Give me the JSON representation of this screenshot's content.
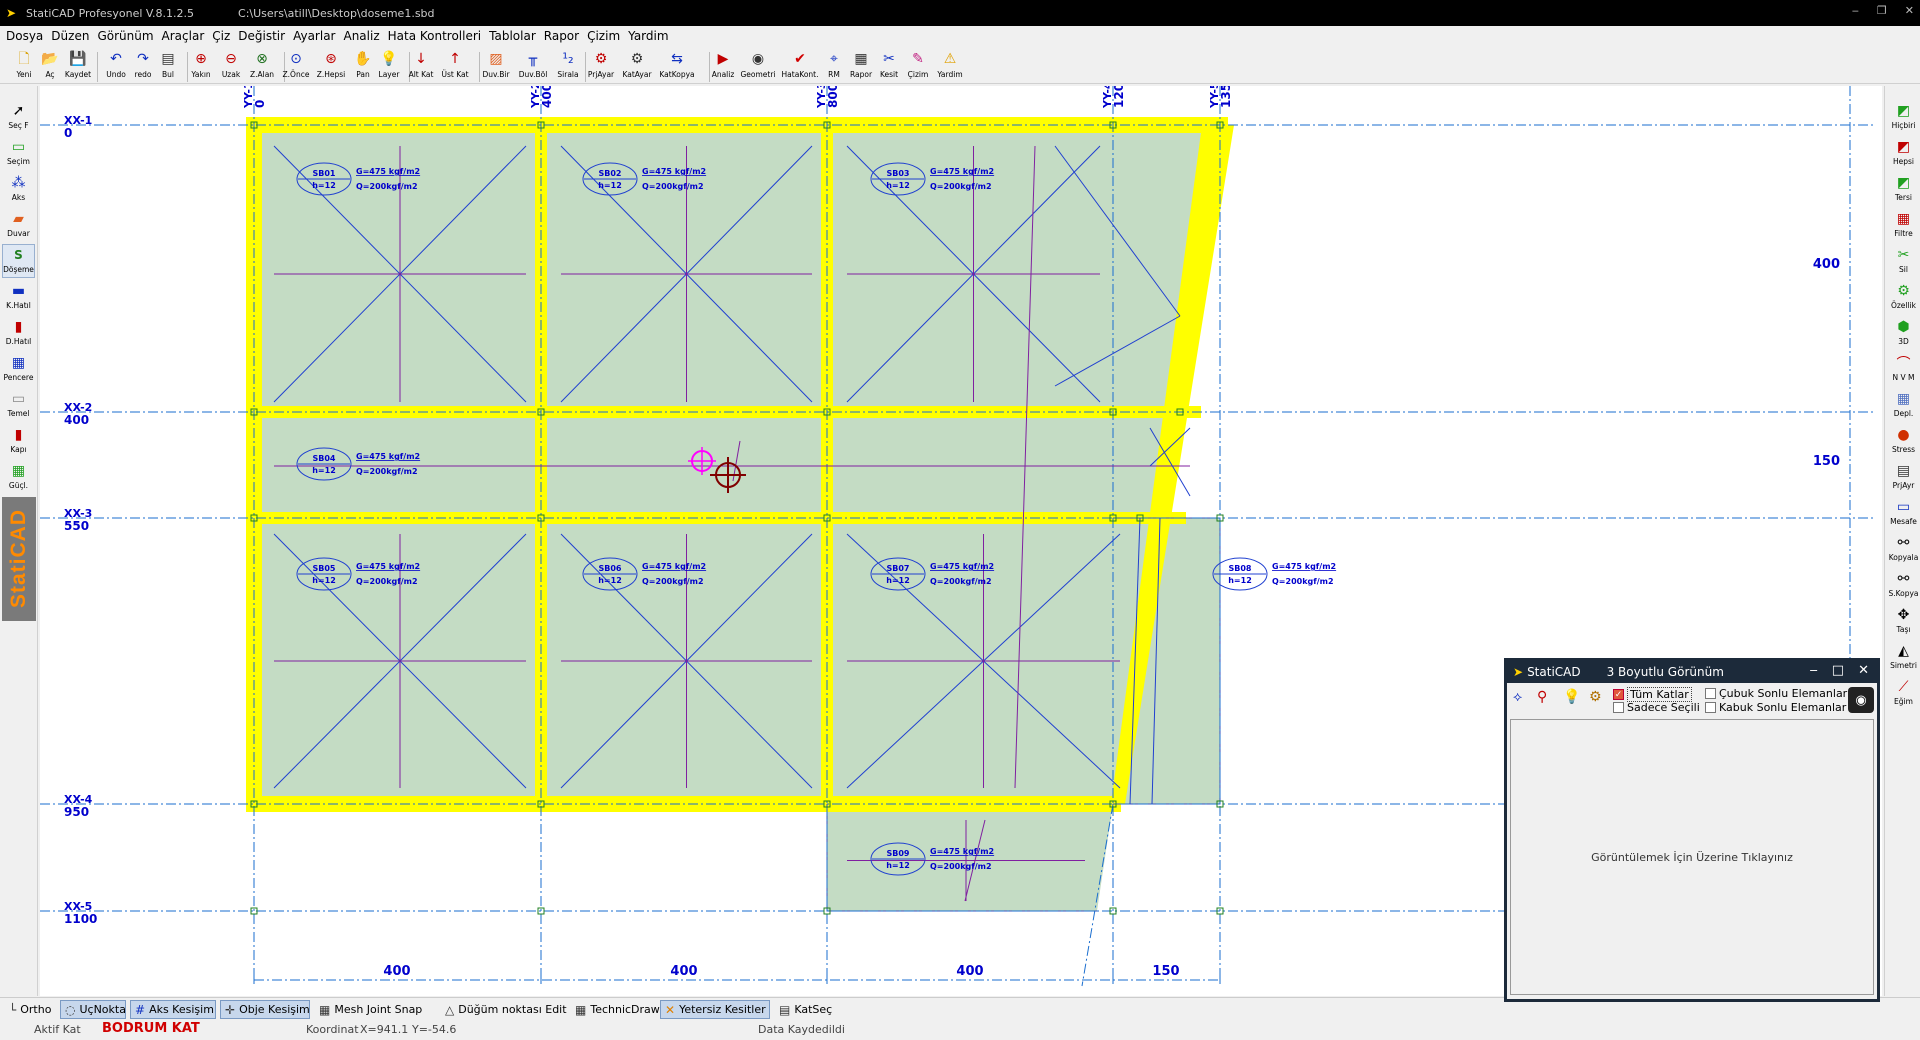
{
  "titlebar": {
    "title": "StatiCAD Profesyonel V.8.1.2.5",
    "path": "C:\\Users\\atill\\Desktop\\doseme1.sbd"
  },
  "menu": [
    "Dosya",
    "Düzen",
    "Görünüm",
    "Araçlar",
    "Çiz",
    "Değistir",
    "Ayarlar",
    "Analiz",
    "Hata Kontrolleri",
    "Tablolar",
    "Rapor",
    "Çizim",
    "Yardim"
  ],
  "toolbar": [
    {
      "label": "Yeni",
      "icon": "new-file-icon",
      "glyph": "🗋",
      "color": "#d8a000"
    },
    {
      "label": "Aç",
      "icon": "open-folder-icon",
      "glyph": "📂",
      "color": "#d8a000"
    },
    {
      "label": "Kaydet",
      "icon": "save-icon",
      "glyph": "💾",
      "color": "#203080"
    },
    {
      "label": "Undo",
      "icon": "undo-icon",
      "glyph": "↶",
      "color": "#1030c0"
    },
    {
      "label": "redo",
      "icon": "redo-icon",
      "glyph": "↷",
      "color": "#1030c0"
    },
    {
      "label": "Bul",
      "icon": "find-icon",
      "glyph": "▤",
      "color": "#333"
    },
    {
      "label": "Yakın",
      "icon": "zoom-in-icon",
      "glyph": "⊕",
      "color": "#c00000"
    },
    {
      "label": "Uzak",
      "icon": "zoom-out-icon",
      "glyph": "⊖",
      "color": "#c00000"
    },
    {
      "label": "Z.Alan",
      "icon": "zoom-area-icon",
      "glyph": "⊗",
      "color": "#207020"
    },
    {
      "label": "Z.Önce",
      "icon": "zoom-previous-icon",
      "glyph": "⊙",
      "color": "#1030c0"
    },
    {
      "label": "Z.Hepsi",
      "icon": "zoom-all-icon",
      "glyph": "⊛",
      "color": "#c00000"
    },
    {
      "label": "Pan",
      "icon": "pan-hand-icon",
      "glyph": "✋",
      "color": "#a07040"
    },
    {
      "label": "Layer",
      "icon": "layer-bulb-icon",
      "glyph": "💡",
      "color": "#e0c000"
    },
    {
      "label": "Alt Kat",
      "icon": "lower-floor-icon",
      "glyph": "↓",
      "color": "#c00000"
    },
    {
      "label": "Üst Kat",
      "icon": "upper-floor-icon",
      "glyph": "↑",
      "color": "#c00000"
    },
    {
      "label": "Duv.Bir",
      "icon": "wall-join-icon",
      "glyph": "▨",
      "color": "#e06020"
    },
    {
      "label": "Duv.Böl",
      "icon": "wall-split-icon",
      "glyph": "╥",
      "color": "#1030c0"
    },
    {
      "label": "Sirala",
      "icon": "sort-icon",
      "glyph": "¹₂",
      "color": "#1030c0"
    },
    {
      "label": "PrjAyar",
      "icon": "project-settings-icon",
      "glyph": "⚙",
      "color": "#c00000"
    },
    {
      "label": "KatAyar",
      "icon": "floor-settings-icon",
      "glyph": "⚙",
      "color": "#333"
    },
    {
      "label": "KatKopya",
      "icon": "floor-copy-icon",
      "glyph": "⇆",
      "color": "#1030c0"
    },
    {
      "label": "Analiz",
      "icon": "analysis-icon",
      "glyph": "▶",
      "color": "#c00000"
    },
    {
      "label": "Geometri",
      "icon": "geometry-icon",
      "glyph": "◉",
      "color": "#333"
    },
    {
      "label": "HataKont.",
      "icon": "error-check-icon",
      "glyph": "✔",
      "color": "#d00000"
    },
    {
      "label": "RM",
      "icon": "rm-icon",
      "glyph": "⌖",
      "color": "#1030c0"
    },
    {
      "label": "Rapor",
      "icon": "report-icon",
      "glyph": "▦",
      "color": "#333"
    },
    {
      "label": "Kesit",
      "icon": "section-icon",
      "glyph": "✂",
      "color": "#1030c0"
    },
    {
      "label": "Çizim",
      "icon": "drawing-icon",
      "glyph": "✎",
      "color": "#c02080"
    },
    {
      "label": "Yardim",
      "icon": "help-icon",
      "glyph": "⚠",
      "color": "#e0a000"
    }
  ],
  "left_tools": [
    {
      "label": "Seç F",
      "icon": "select-arrow-icon",
      "glyph": "➚",
      "color": "#000"
    },
    {
      "label": "Seçim",
      "icon": "selection-icon",
      "glyph": "▭",
      "color": "#20a020"
    },
    {
      "label": "Aks",
      "icon": "axis-icon",
      "glyph": "⁂",
      "color": "#1030c0"
    },
    {
      "label": "Duvar",
      "icon": "wall-icon",
      "glyph": "▰",
      "color": "#e06020"
    },
    {
      "label": "Döşeme",
      "icon": "slab-icon",
      "glyph": "S",
      "color": "#208020",
      "active": true
    },
    {
      "label": "K.Hatıl",
      "icon": "beam-icon",
      "glyph": "▬",
      "color": "#1030c0"
    },
    {
      "label": "D.Hatıl",
      "icon": "d-beam-icon",
      "glyph": "▮",
      "color": "#c00000"
    },
    {
      "label": "Pencere",
      "icon": "window-icon",
      "glyph": "▦",
      "color": "#1030c0"
    },
    {
      "label": "Temel",
      "icon": "foundation-icon",
      "glyph": "▭",
      "color": "#888"
    },
    {
      "label": "Kapı",
      "icon": "door-icon",
      "glyph": "▮",
      "color": "#c00000"
    },
    {
      "label": "Güçl.",
      "icon": "reinforce-icon",
      "glyph": "▦",
      "color": "#20a020"
    }
  ],
  "brand": "StatiCAD",
  "right_tools": [
    {
      "label": "Hiçbiri",
      "icon": "select-none-icon",
      "glyph": "◩",
      "color": "#20a020"
    },
    {
      "label": "Hepsi",
      "icon": "select-all-icon",
      "glyph": "◩",
      "color": "#c00000"
    },
    {
      "label": "Tersi",
      "icon": "invert-selection-icon",
      "glyph": "◩",
      "color": "#20a020"
    },
    {
      "label": "Filtre",
      "icon": "filter-icon",
      "glyph": "▦",
      "color": "#c00000"
    },
    {
      "label": "Sil",
      "icon": "delete-icon",
      "glyph": "✂",
      "color": "#20a020"
    },
    {
      "label": "Özellik",
      "icon": "properties-icon",
      "glyph": "⚙",
      "color": "#20a020"
    },
    {
      "label": "3D",
      "icon": "3d-view-icon",
      "glyph": "⬢",
      "color": "#20a020"
    },
    {
      "label": "N V M",
      "icon": "nvm-icon",
      "glyph": "⌒",
      "color": "#c00000"
    },
    {
      "label": "Depl.",
      "icon": "displacement-icon",
      "glyph": "▦",
      "color": "#5070c0"
    },
    {
      "label": "Stress",
      "icon": "stress-icon",
      "glyph": "●",
      "color": "#d03000"
    },
    {
      "label": "PrjAyr",
      "icon": "project-adjust-icon",
      "glyph": "▤",
      "color": "#333"
    },
    {
      "label": "Mesafe",
      "icon": "distance-icon",
      "glyph": "▭",
      "color": "#1030c0"
    },
    {
      "label": "Kopyala",
      "icon": "copy-icon",
      "glyph": "⚯",
      "color": "#000"
    },
    {
      "label": "S.Kopya",
      "icon": "special-copy-icon",
      "glyph": "⚯",
      "color": "#000"
    },
    {
      "label": "Taşı",
      "icon": "move-icon",
      "glyph": "✥",
      "color": "#000"
    },
    {
      "label": "Simetri",
      "icon": "mirror-icon",
      "glyph": "◭",
      "color": "#000"
    },
    {
      "label": "Eğim",
      "icon": "slope-icon",
      "glyph": "⟋",
      "color": "#c00000"
    }
  ],
  "axes": {
    "vertical": [
      {
        "name": "YY-1",
        "value": "0"
      },
      {
        "name": "YY-2",
        "value": "400"
      },
      {
        "name": "YY-3",
        "value": "800"
      },
      {
        "name": "YY-4",
        "value": "1200"
      },
      {
        "name": "YY-5",
        "value": "1350"
      }
    ],
    "horizontal": [
      {
        "name": "XX-1",
        "value": "0"
      },
      {
        "name": "XX-2",
        "value": "400"
      },
      {
        "name": "XX-3",
        "value": "550"
      },
      {
        "name": "XX-4",
        "value": "950"
      },
      {
        "name": "XX-5",
        "value": "1100"
      }
    ],
    "bottom_dims": [
      "400",
      "400",
      "400",
      "150"
    ],
    "right_dims": [
      "400",
      "150"
    ]
  },
  "slabs": [
    {
      "id": "SB01",
      "h": "h=12",
      "g": "G=475 kgf/m2",
      "q": "Q=200kgf/m2"
    },
    {
      "id": "SB02",
      "h": "h=12",
      "g": "G=475 kgf/m2",
      "q": "Q=200kgf/m2"
    },
    {
      "id": "SB03",
      "h": "h=12",
      "g": "G=475 kgf/m2",
      "q": "Q=200kgf/m2"
    },
    {
      "id": "SB04",
      "h": "h=12",
      "g": "G=475 kgf/m2",
      "q": "Q=200kgf/m2"
    },
    {
      "id": "SB05",
      "h": "h=12",
      "g": "G=475 kgf/m2",
      "q": "Q=200kgf/m2"
    },
    {
      "id": "SB06",
      "h": "h=12",
      "g": "G=475 kgf/m2",
      "q": "Q=200kgf/m2"
    },
    {
      "id": "SB07",
      "h": "h=12",
      "g": "G=475 kgf/m2",
      "q": "Q=200kgf/m2"
    },
    {
      "id": "SB08",
      "h": "h=12",
      "g": "G=475 kgf/m2",
      "q": "Q=200kgf/m2"
    },
    {
      "id": "SB09",
      "h": "h=12",
      "g": "G=475 kgf/m2",
      "q": "Q=200kgf/m2"
    }
  ],
  "status_buttons": [
    {
      "label": "Ortho",
      "icon": "ortho-icon",
      "glyph": "└",
      "active": false
    },
    {
      "label": "UçNokta",
      "icon": "endpoint-icon",
      "glyph": "◌",
      "active": true
    },
    {
      "label": "Aks Kesişim",
      "icon": "axis-intersection-icon",
      "glyph": "#",
      "active": true
    },
    {
      "label": "Obje Kesişim",
      "icon": "object-intersection-icon",
      "glyph": "✛",
      "active": true
    },
    {
      "label": "Mesh Joint Snap",
      "icon": "mesh-joint-icon",
      "glyph": "▦",
      "active": false
    },
    {
      "label": "Düğüm noktası Edit",
      "icon": "node-edit-icon",
      "glyph": "△",
      "active": false
    },
    {
      "label": "TechnicDraw",
      "icon": "technic-draw-icon",
      "glyph": "▦",
      "active": false
    },
    {
      "label": "Yetersiz Kesitler",
      "icon": "insufficient-sections-icon",
      "glyph": "✕",
      "active": true
    },
    {
      "label": "KatSeç",
      "icon": "floor-select-icon",
      "glyph": "▤",
      "active": false
    }
  ],
  "info": {
    "active_floor_label": "Aktif Kat",
    "active_floor": "BODRUM KAT",
    "coord_label": "Koordinat",
    "x": "X=941.1",
    "y": "Y=-54.6",
    "status": "Data Kaydedildi"
  },
  "view3d": {
    "app": "StatiCAD",
    "title": "3 Boyutlu Görünüm",
    "all_floors": "Tüm Katlar",
    "selected_only": "Sadece Seçili",
    "bar_elements": "Çubuk Sonlu Elemanlar",
    "shell_elements": "Kabuk Sonlu Elemanlar",
    "prompt": "Görüntülemek İçin Üzerine Tıklayınız"
  },
  "colors": {
    "beam": "#ffff00",
    "slab": "#c4dcc4",
    "axis": "#1a6ecf",
    "text": "#0000cc",
    "accent_red": "#cc0000"
  }
}
